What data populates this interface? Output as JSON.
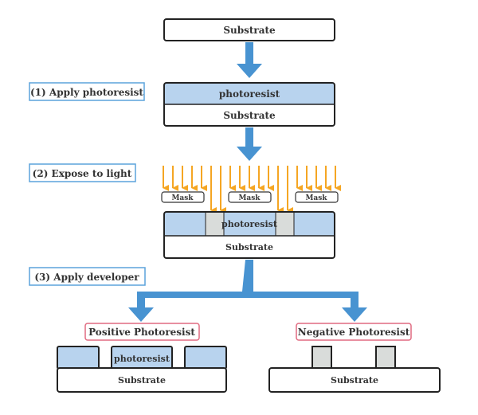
{
  "colors": {
    "arrow": "#4893d1",
    "light": "#f5a623",
    "resist": "#b8d3ee",
    "exposed": "#d9dcda",
    "label_border_step": "#5ba3dc",
    "label_border_result": "#e06a80"
  },
  "boxes": {
    "substrate": "Substrate",
    "photoresist": "photoresist",
    "mask": "Mask"
  },
  "steps": [
    "(1) Apply photoresist",
    "(2) Expose to light",
    "(3) Apply developer"
  ],
  "results": {
    "positive": "Positive Photoresist",
    "negative": "Negative Photoresist"
  }
}
